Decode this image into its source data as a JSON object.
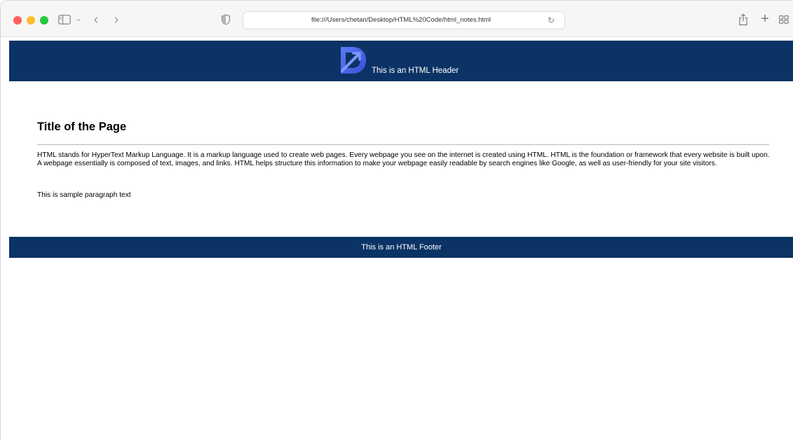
{
  "browser": {
    "url": "file:///Users/chetan/Desktop/HTML%20Code/html_notes.html",
    "icons": {
      "sidebar": "sidebar-icon",
      "back": "chevron-left-icon",
      "forward": "chevron-right-icon",
      "privacy": "shield-icon",
      "reload": "reload-icon",
      "share": "share-icon",
      "new_tab": "plus-icon",
      "tab_overview": "grid-icon"
    },
    "back_glyph": "‹",
    "forward_glyph": "›",
    "chevron_glyph": "⌄",
    "reload_glyph": "↻",
    "plus_glyph": "+"
  },
  "page": {
    "header": {
      "text": "This is an HTML Header",
      "background": "#0b3366"
    },
    "title": "Title of the Page",
    "paragraphs": [
      "HTML stands for HyperText Markup Language. It is a markup language used to create web pages. Every webpage you see on the internet is created using HTML. HTML is the foundation or framework that every website is built upon. A webpage essentially is composed of text, images, and links. HTML helps structure this information to make your webpage easily readable by search engines like Google, as well as user-friendly for your site visitors.",
      "This is sample paragraph text"
    ],
    "footer": {
      "text": "This is an HTML Footer",
      "background": "#0b3366"
    },
    "logo_color": "#4c6cf0"
  }
}
